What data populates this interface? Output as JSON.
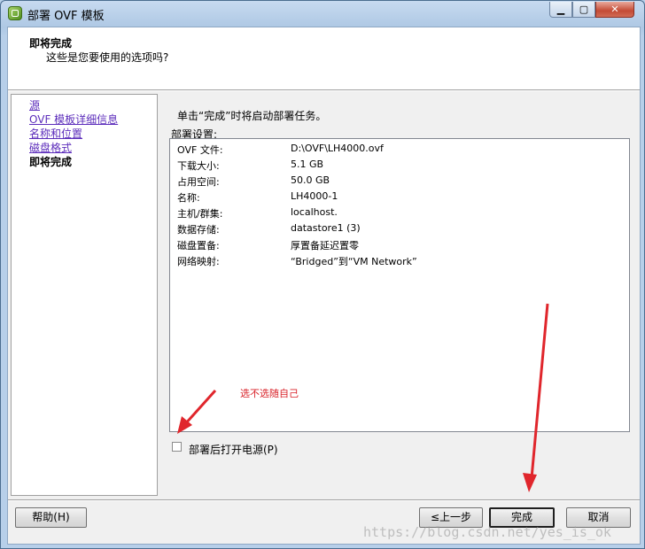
{
  "window": {
    "title": "部署 OVF 模板"
  },
  "header": {
    "title": "即将完成",
    "subtitle": "这些是您要使用的选项吗?"
  },
  "nav": {
    "items": [
      {
        "label": "源"
      },
      {
        "label": "OVF 模板详细信息"
      },
      {
        "label": "名称和位置"
      },
      {
        "label": "磁盘格式"
      },
      {
        "label": "即将完成"
      }
    ]
  },
  "main": {
    "info": "单击“完成”时将启动部署任务。",
    "settings_label": "部署设置:",
    "settings": [
      {
        "key": "OVF 文件:",
        "value": "D:\\OVF\\LH4000.ovf"
      },
      {
        "key": "下载大小:",
        "value": "5.1 GB"
      },
      {
        "key": "占用空间:",
        "value": "50.0 GB"
      },
      {
        "key": "名称:",
        "value": "LH4000-1"
      },
      {
        "key": "主机/群集:",
        "value": "localhost."
      },
      {
        "key": "数据存储:",
        "value": "datastore1 (3)"
      },
      {
        "key": "磁盘置备:",
        "value": "厚置备延迟置零"
      },
      {
        "key": "网络映射:",
        "value": "“Bridged”到“VM Network”"
      }
    ],
    "annotation": "选不选随自己",
    "power_on_label": "部署后打开电源(P)"
  },
  "footer": {
    "help": "帮助(H)",
    "back": "≤上一步",
    "finish": "完成",
    "cancel": "取消"
  },
  "watermark": "https://blog.csdn.net/yes_is_ok",
  "colors": {
    "annotation_red": "#d9232a",
    "link_purple": "#5c2dbb"
  }
}
